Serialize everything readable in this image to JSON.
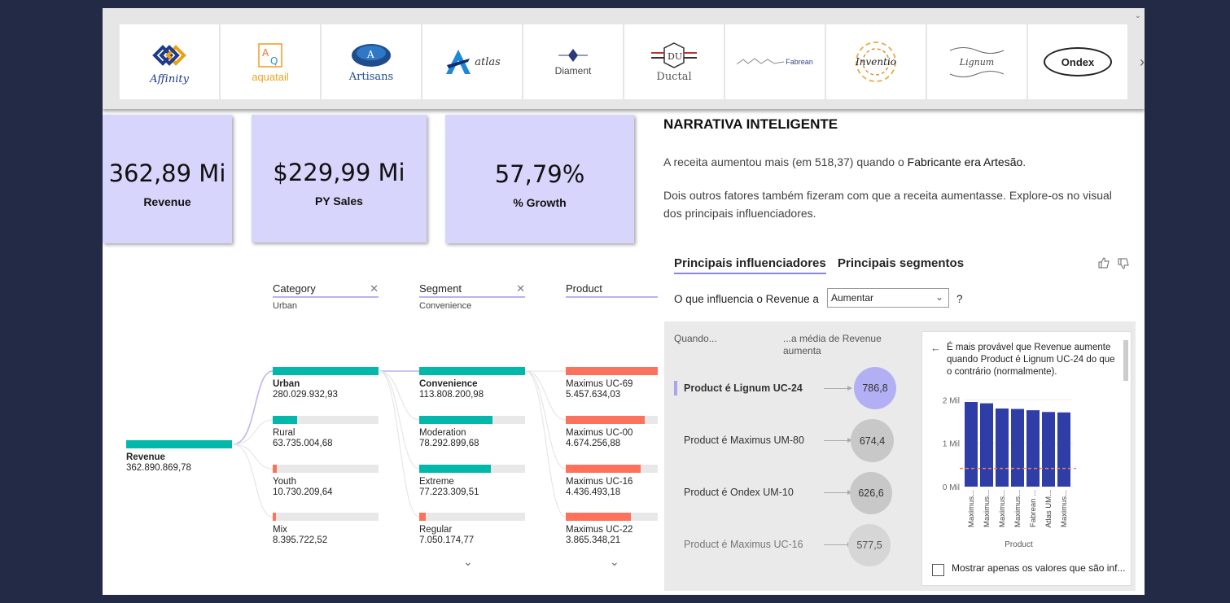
{
  "logos": [
    {
      "name": "Affinity"
    },
    {
      "name": "aquatail"
    },
    {
      "name": "Artisans"
    },
    {
      "name": "atlas"
    },
    {
      "name": "Diament"
    },
    {
      "name": "Ductal"
    },
    {
      "name": "Fabrean"
    },
    {
      "name": "Inventio"
    },
    {
      "name": "Lignum"
    },
    {
      "name": "Ondex"
    }
  ],
  "kpis": [
    {
      "value": "362,89 Mi",
      "label": "Revenue"
    },
    {
      "value": "$229,99 Mi",
      "label": "PY Sales"
    },
    {
      "value": "57,79%",
      "label": "% Growth"
    }
  ],
  "tree": {
    "root": {
      "label": "Revenue",
      "value": "362.890.869,78",
      "fill": 1.0
    },
    "columns": [
      {
        "header": "Category",
        "sub": "Urban",
        "closable": true
      },
      {
        "header": "Segment",
        "sub": "Convenience",
        "closable": true
      },
      {
        "header": "Product",
        "sub": "",
        "closable": false
      }
    ],
    "category": [
      {
        "label": "Urban",
        "value": "280.029.932,93",
        "fill": 1.0
      },
      {
        "label": "Rural",
        "value": "63.735.004,68",
        "fill": 0.23
      },
      {
        "label": "Youth",
        "value": "10.730.209,64",
        "fill": 0.04
      },
      {
        "label": "Mix",
        "value": "8.395.722,52",
        "fill": 0.03
      }
    ],
    "segment": [
      {
        "label": "Convenience",
        "value": "113.808.200,98",
        "fill": 1.0
      },
      {
        "label": "Moderation",
        "value": "78.292.899,68",
        "fill": 0.69
      },
      {
        "label": "Extreme",
        "value": "77.223.309,51",
        "fill": 0.68
      },
      {
        "label": "Regular",
        "value": "7.050.174,77",
        "fill": 0.06
      }
    ],
    "product": [
      {
        "label": "Maximus UC-69",
        "value": "5.457.634,03",
        "fill": 1.0
      },
      {
        "label": "Maximus UC-00",
        "value": "4.674.256,88",
        "fill": 0.86
      },
      {
        "label": "Maximus UC-16",
        "value": "4.436.493,18",
        "fill": 0.81
      },
      {
        "label": "Maximus UC-22",
        "value": "3.865.348,21",
        "fill": 0.71
      }
    ]
  },
  "narrative": {
    "title": "NARRATIVA INTELIGENTE",
    "p1_pre": "A receita aumentou mais (em 518,37) quando o ",
    "p1_bold": "Fabricante era Artesão",
    "p1_post": ".",
    "p2": "Dois outros fatores também fizeram com que a receita aumentasse. Explore-os no visual dos principais influenciadores."
  },
  "key_influencers": {
    "tab1": "Principais influenciadores",
    "tab2": "Principais segmentos",
    "question_pre": "O que influencia o Revenue a",
    "dropdown_value": "Aumentar",
    "question_post": "?",
    "col_when": "Quando...",
    "col_avg": "...a média de Revenue aumenta",
    "rows": [
      {
        "label": "Product é Lignum UC-24",
        "value": "786,8",
        "selected": true
      },
      {
        "label": "Product é Maximus UM-80",
        "value": "674,4",
        "selected": false
      },
      {
        "label": "Product é Ondex UM-10",
        "value": "626,6",
        "selected": false
      },
      {
        "label": "Product é Maximus UC-16",
        "value": "577,5",
        "selected": false
      }
    ],
    "detail_text": "É mais provável que Revenue aumente quando Product é Lignum UC-24 do que o contrário (normalmente).",
    "checkbox_label": "Mostrar apenas os valores que são inf..."
  },
  "chart_data": {
    "type": "bar",
    "categories": [
      "Maximus...",
      "Maximus...",
      "Maximus...",
      "Maximus...",
      "Fabrean ...",
      "Atlas UM...",
      "Maximus..."
    ],
    "values": [
      1.95,
      1.92,
      1.8,
      1.79,
      1.76,
      1.72,
      1.71
    ],
    "xlabel": "Product",
    "ylabel": "",
    "yticks": [
      "0 Mil",
      "1 Mil",
      "2 Mil"
    ],
    "ylim": [
      0,
      2.1
    ],
    "reference_line": 0.42,
    "bar_color": "#2e3ea6",
    "reference_color": "#e8806a"
  },
  "colors": {
    "kpi_bg": "#d7d5fb",
    "teal": "#01b8aa",
    "coral": "#fd725d",
    "chart_bar": "#2e3ea6",
    "bubble_selected": "#b3aff4",
    "bubble_default": "#c8c8c8"
  },
  "icons": [
    "thumbs-up-icon",
    "thumbs-down-icon",
    "back-arrow-icon",
    "chevron-down-icon",
    "close-icon",
    "next-arrow-icon"
  ]
}
